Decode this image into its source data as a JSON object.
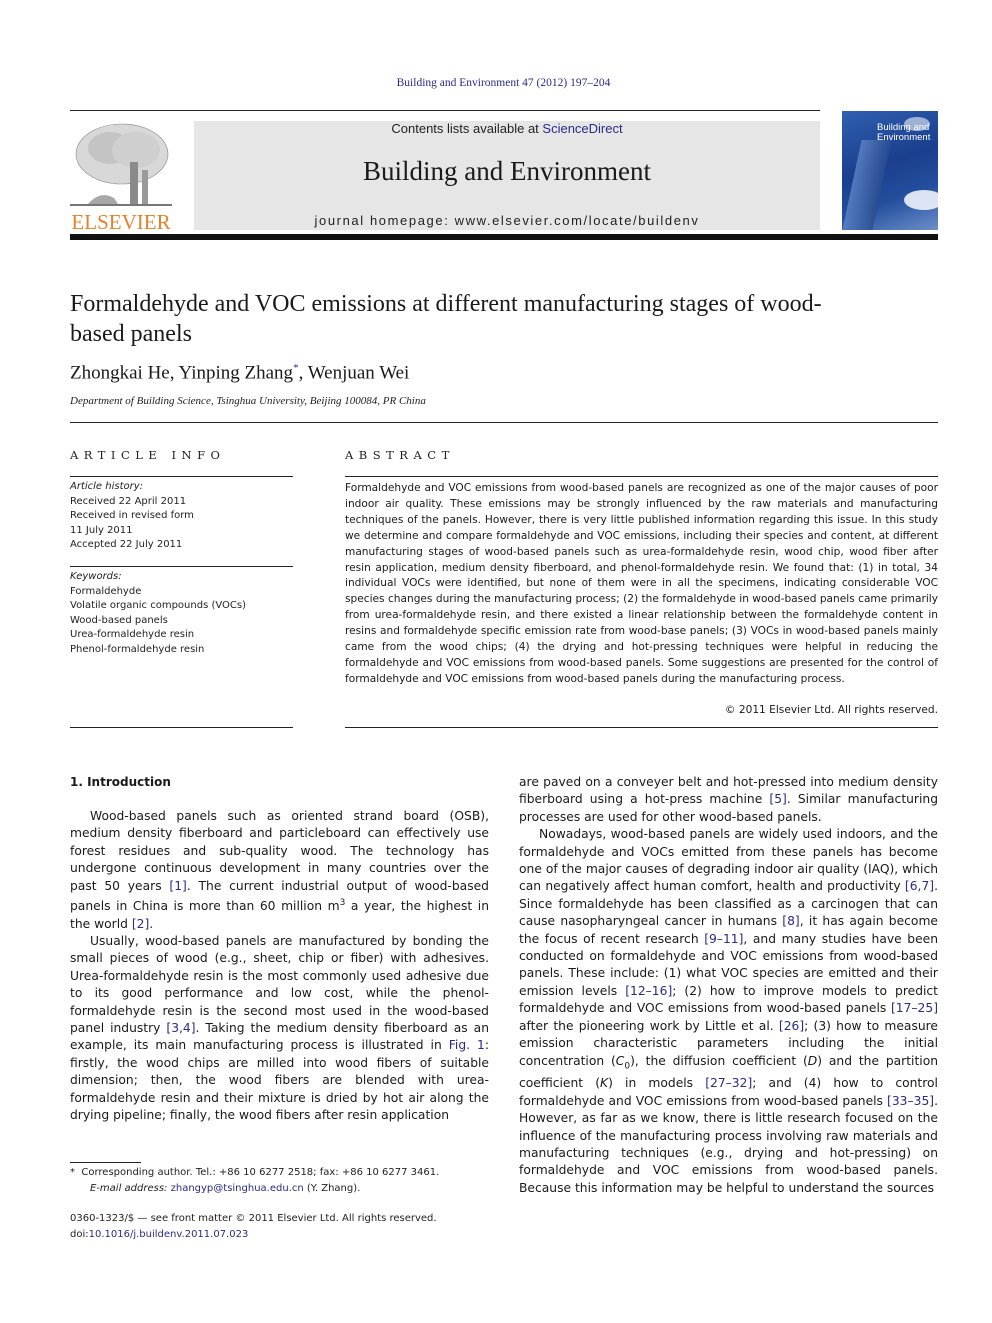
{
  "header": {
    "journal_ref": "Building and Environment 47 (2012) 197–204",
    "contents_prefix": "Contents lists available at ",
    "contents_link": "ScienceDirect",
    "journal_name": "Building and Environment",
    "homepage": "journal homepage: www.elsevier.com/locate/buildenv",
    "publisher_logo": "ELSEVIER",
    "cover_title_line1": "Building and",
    "cover_title_line2": "Environment"
  },
  "article": {
    "title": "Formaldehyde and VOC emissions at different manufacturing stages of wood-based panels",
    "authors": [
      {
        "name": "Zhongkai He",
        "sep": ", "
      },
      {
        "name": "Yinping Zhang",
        "mark": "*",
        "sep": ", "
      },
      {
        "name": "Wenjuan Wei",
        "sep": ""
      }
    ],
    "affiliation": "Department of Building Science, Tsinghua University, Beijing 100084, PR China"
  },
  "article_info": {
    "heading": "ARTICLE INFO",
    "history_label": "Article history:",
    "history": [
      "Received 22 April 2011",
      "Received in revised form",
      "11 July 2011",
      "Accepted 22 July 2011"
    ],
    "keywords_label": "Keywords:",
    "keywords": [
      "Formaldehyde",
      "Volatile organic compounds (VOCs)",
      "Wood-based panels",
      "Urea-formaldehyde resin",
      "Phenol-formaldehyde resin"
    ]
  },
  "abstract": {
    "heading": "ABSTRACT",
    "text": "Formaldehyde and VOC emissions from wood-based panels are recognized as one of the major causes of poor indoor air quality. These emissions may be strongly influenced by the raw materials and manufacturing techniques of the panels. However, there is very little published information regarding this issue. In this study we determine and compare formaldehyde and VOC emissions, including their species and content, at different manufacturing stages of wood-based panels such as urea-formaldehyde resin, wood chip, wood fiber after resin application, medium density fiberboard, and phenol-formaldehyde resin. We found that: (1) in total, 34 individual VOCs were identified, but none of them were in all the specimens, indicating considerable VOC species changes during the manufacturing process; (2) the formaldehyde in wood-based panels came primarily from urea-formaldehyde resin, and there existed a linear relationship between the formaldehyde content in resins and formaldehyde specific emission rate from wood-base panels; (3) VOCs in wood-based panels mainly came from the wood chips; (4) the drying and hot-pressing techniques were helpful in reducing the formaldehyde and VOC emissions from wood-based panels. Some suggestions are presented for the control of formaldehyde and VOC emissions from wood-based panels during the manufacturing process.",
    "copyright": "© 2011 Elsevier Ltd. All rights reserved."
  },
  "introduction": {
    "heading": "1.  Introduction",
    "left": [
      [
        {
          "t": "Wood-based panels such as oriented strand board (OSB), medium density fiberboard and particleboard can effectively use forest residues and sub-quality wood. The technology has undergone continuous development in many countries over the past 50 years "
        },
        {
          "ref": "[1]"
        },
        {
          "t": ". The current industrial output of wood-based panels in China is more than 60 million m"
        },
        {
          "sup": "3"
        },
        {
          "t": " a year, the highest in the world "
        },
        {
          "ref": "[2]"
        },
        {
          "t": "."
        }
      ],
      [
        {
          "t": "Usually, wood-based panels are manufactured by bonding the small pieces of wood (e.g., sheet, chip or fiber) with adhesives. Urea-formaldehyde resin is the most commonly used adhesive due to its good performance and low cost, while the phenol-formaldehyde resin is the second most used in the wood-based panel industry "
        },
        {
          "ref": "[3,4]"
        },
        {
          "t": ". Taking the medium density fiberboard as an example, its main manufacturing process is illustrated in "
        },
        {
          "ref": "Fig. 1"
        },
        {
          "t": ": firstly, the wood chips are milled into wood fibers of suitable dimension; then, the wood fibers are blended with urea-formaldehyde resin and their mixture is dried by hot air along the drying pipeline; finally, the wood fibers after resin application"
        }
      ]
    ],
    "right": [
      [
        {
          "t": "are paved on a conveyer belt and hot-pressed into medium density fiberboard using a hot-press machine "
        },
        {
          "ref": "[5]"
        },
        {
          "t": ". Similar manufacturing processes are used for other wood-based panels."
        }
      ],
      [
        {
          "t": "Nowadays, wood-based panels are widely used indoors, and the formaldehyde and VOCs emitted from these panels has become one of the major causes of degrading indoor air quality (IAQ), which can negatively affect human comfort, health and productivity "
        },
        {
          "ref": "[6,7]"
        },
        {
          "t": ". Since formaldehyde has been classified as a carcinogen that can cause nasopharyngeal cancer in humans "
        },
        {
          "ref": "[8]"
        },
        {
          "t": ", it has again become the focus of recent research "
        },
        {
          "ref": "[9–11]"
        },
        {
          "t": ", and many studies have been conducted on formaldehyde and VOC emissions from wood-based panels. These include: (1) what VOC species are emitted and their emission levels "
        },
        {
          "ref": "[12–16]"
        },
        {
          "t": "; (2) how to improve models to predict formaldehyde and VOC emissions from wood-based panels "
        },
        {
          "ref": "[17–25]"
        },
        {
          "t": " after the pioneering work by Little et al. "
        },
        {
          "ref": "[26]"
        },
        {
          "t": "; (3) how to measure emission characteristic parameters including the initial concentration ("
        },
        {
          "i": "C"
        },
        {
          "sub": "0"
        },
        {
          "t": "), the diffusion coefficient ("
        },
        {
          "i": "D"
        },
        {
          "t": ") and the partition coefficient ("
        },
        {
          "i": "K"
        },
        {
          "t": ") in models "
        },
        {
          "ref": "[27–32]"
        },
        {
          "t": "; and (4) how to control formaldehyde and VOC emissions from wood-based panels "
        },
        {
          "ref": "[33–35]"
        },
        {
          "t": ". However, as far as we know, there is little research focused on the influence of the manufacturing process involving raw materials and manufacturing techniques (e.g., drying and hot-pressing) on formaldehyde and VOC emissions from wood-based panels. Because this information may be helpful to understand the sources"
        }
      ]
    ]
  },
  "footnote": {
    "mark": "*",
    "corresponding": "Corresponding author. Tel.: +86 10 6277 2518; fax: +86 10 6277 3461.",
    "email_label": "E-mail address:",
    "email": "zhangyp@tsinghua.edu.cn",
    "email_suffix": " (Y. Zhang).",
    "issn": "0360-1323/$ — see front matter © 2011 Elsevier Ltd. All rights reserved.",
    "doi_label": "doi:",
    "doi": "10.1016/j.buildenv.2011.07.023"
  },
  "colors": {
    "link": "#2a2a8a",
    "elsevier_orange": "#e8802a",
    "header_band": "#e6e6e6",
    "cover_blue": "#1a3f8e"
  }
}
